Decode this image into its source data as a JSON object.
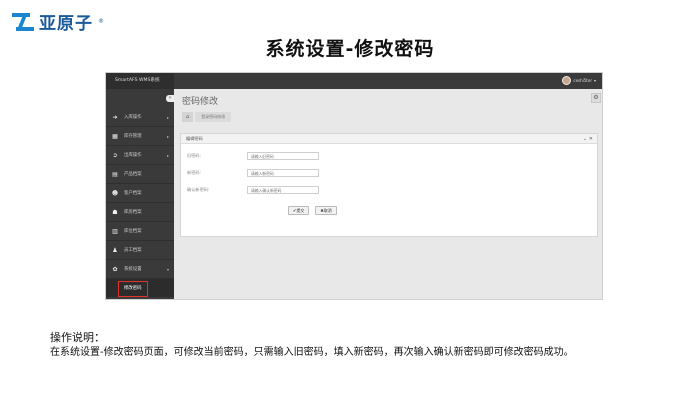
{
  "logo": {
    "text": "亚原子",
    "reg": "®"
  },
  "slide_title": "系统设置-修改密码",
  "app": {
    "brand": "SmartAFS WMS系统",
    "user_name": "ceshi5ter",
    "sidebar": {
      "items": [
        {
          "icon": "➜",
          "label": "入库操作",
          "arrow": "▸"
        },
        {
          "icon": "▦",
          "label": "库存管理",
          "arrow": "▸"
        },
        {
          "icon": "➲",
          "label": "出库操作",
          "arrow": "▸"
        },
        {
          "icon": "▤",
          "label": "产品档案",
          "arrow": ""
        },
        {
          "icon": "☻",
          "label": "客户档案",
          "arrow": ""
        },
        {
          "icon": "☗",
          "label": "库房档案",
          "arrow": ""
        },
        {
          "icon": "▥",
          "label": "库位档案",
          "arrow": ""
        },
        {
          "icon": "♟",
          "label": "员工档案",
          "arrow": ""
        },
        {
          "icon": "✿",
          "label": "系统设置",
          "arrow": "▾"
        }
      ],
      "sub_item": "修改密码"
    },
    "page_heading": "密码修改",
    "breadcrumb": {
      "home": "⌂",
      "current": "登录密码修改"
    },
    "panel": {
      "title": "编辑密码",
      "tools": "⌄ ✕",
      "fields": [
        {
          "label": "旧密码:",
          "placeholder": "请输入旧密码"
        },
        {
          "label": "新密码:",
          "placeholder": "请输入新密码"
        },
        {
          "label": "确认新密码:",
          "placeholder": "请输入确认新密码"
        }
      ],
      "submit_label": "✔提交",
      "cancel_label": "✖取消"
    }
  },
  "instructions": {
    "title": "操作说明：",
    "body": "在系统设置-修改密码页面，可修改当前密码，只需输入旧密码，填入新密码，再次输入确认新密码即可修改密码成功。"
  }
}
